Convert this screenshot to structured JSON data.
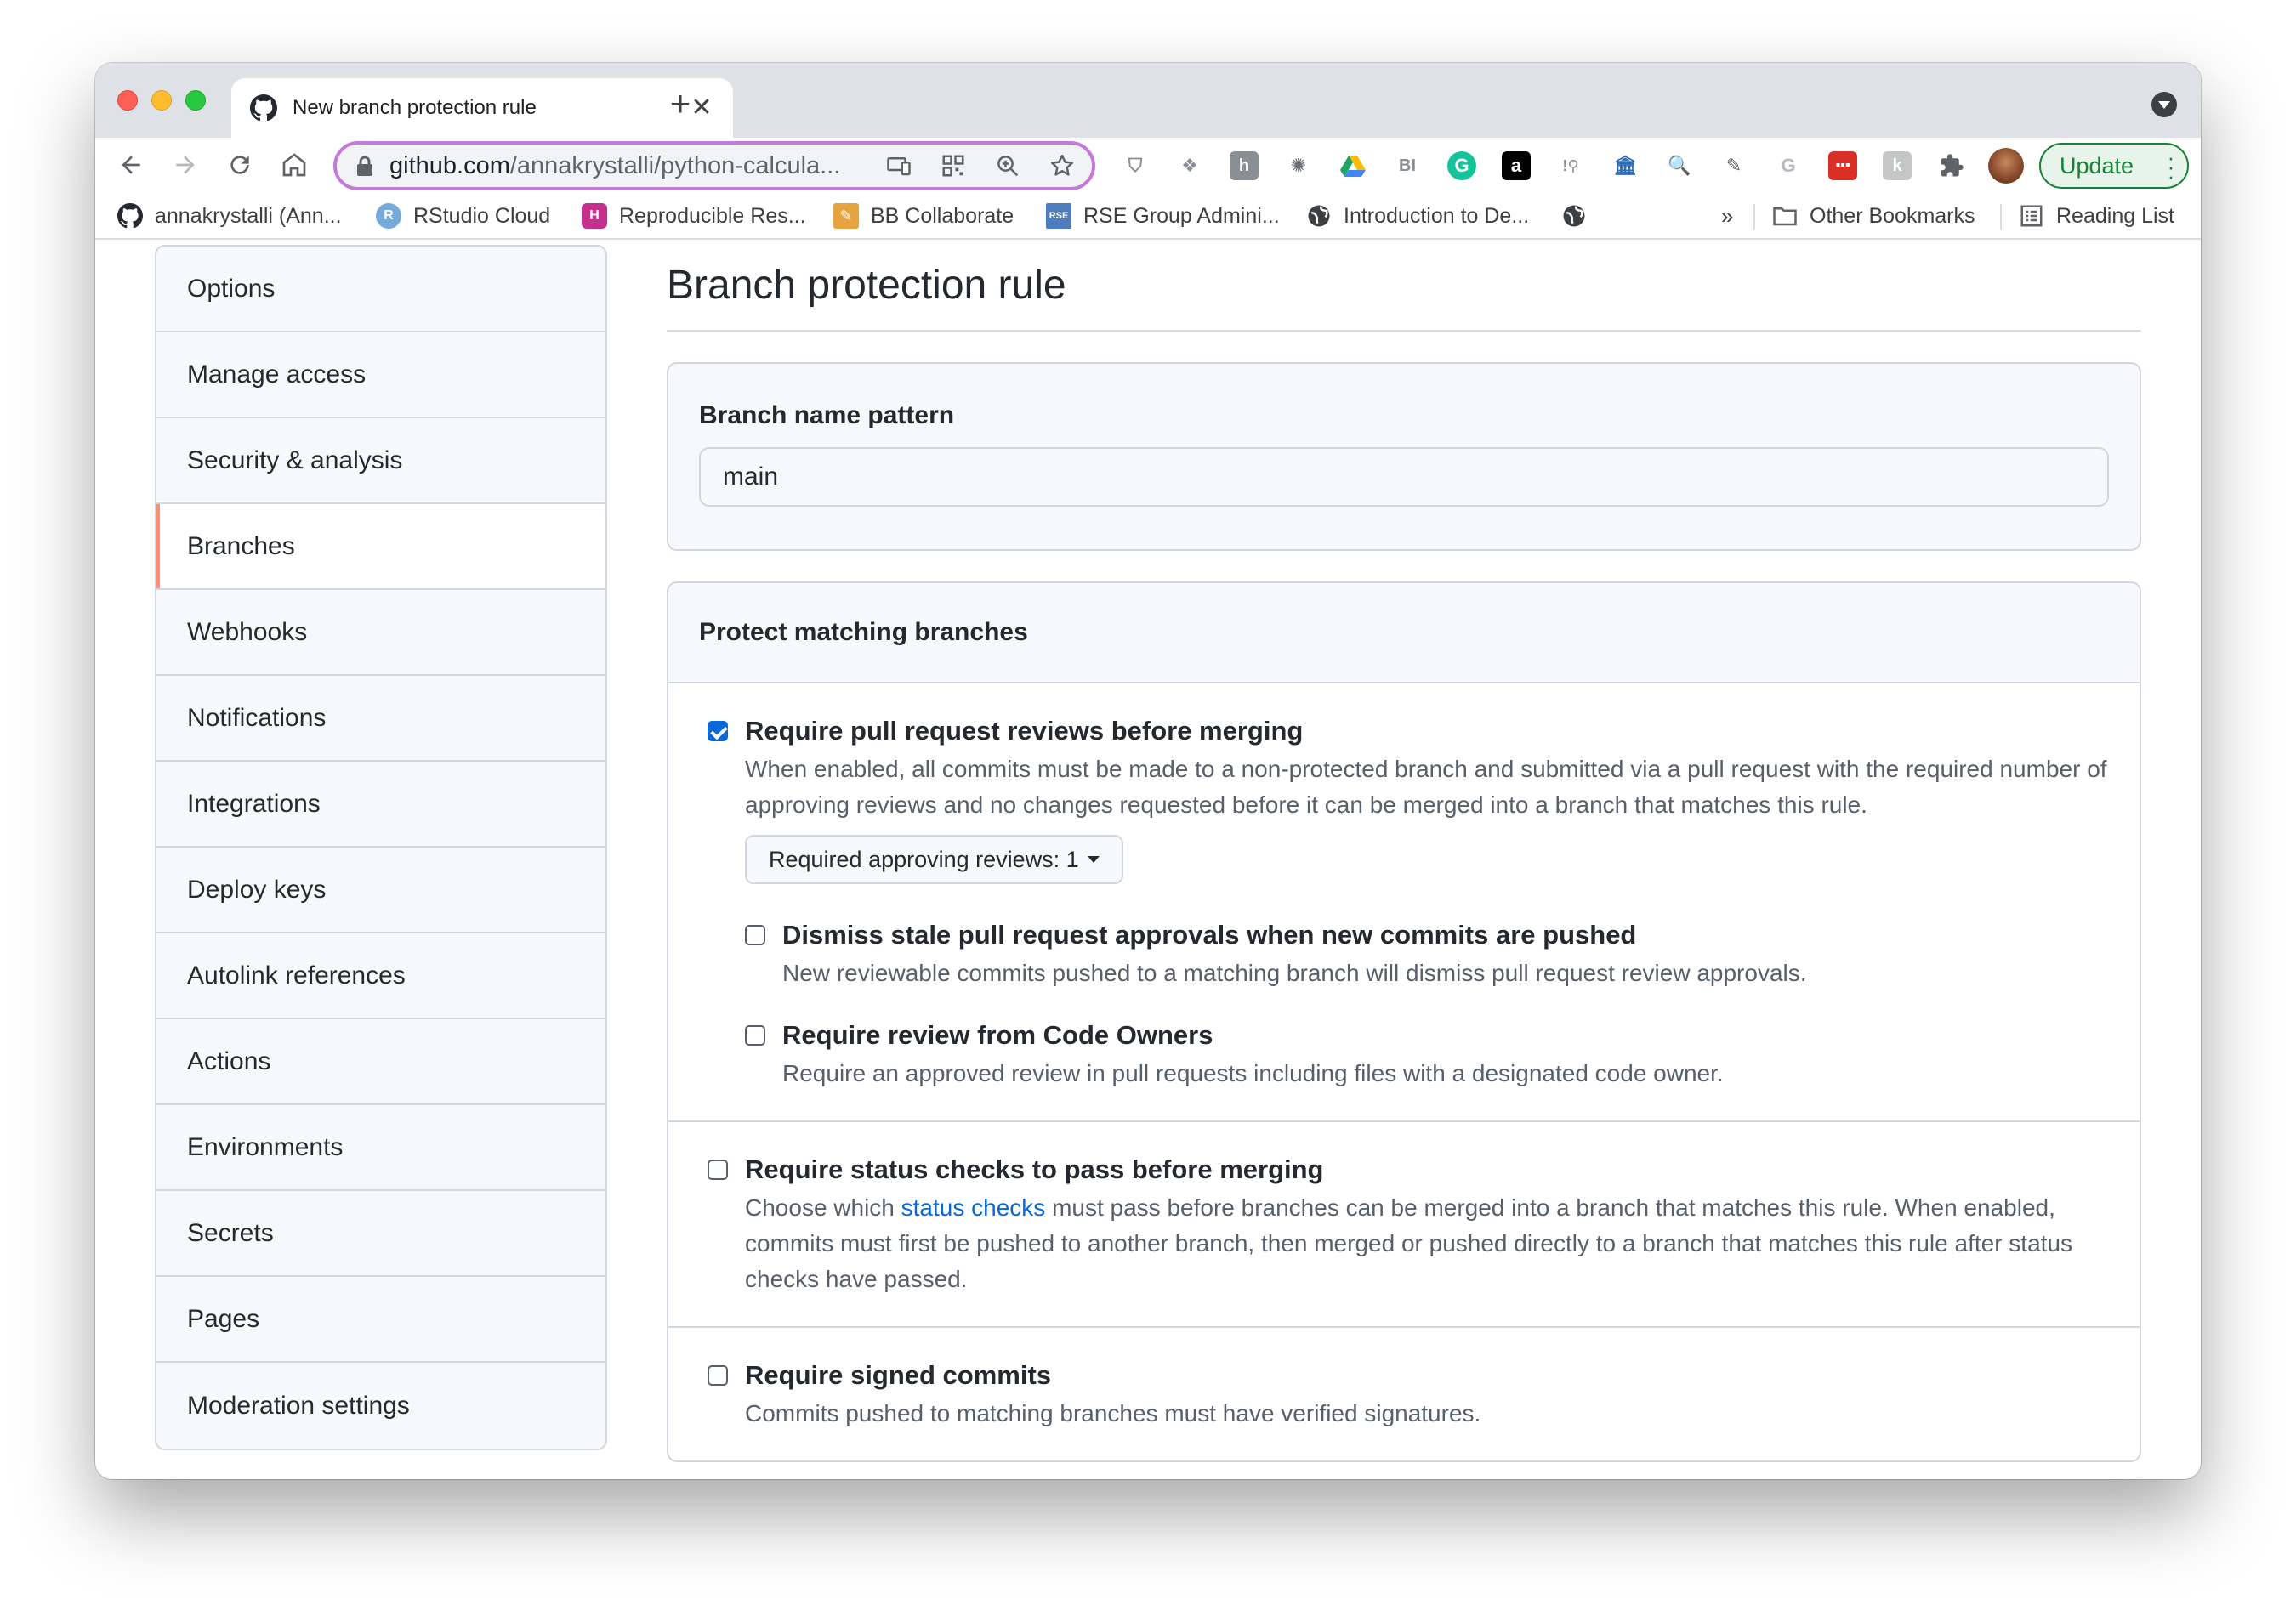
{
  "browser": {
    "tab_title": "New branch protection rule",
    "tab_close": "✕",
    "new_tab": "+",
    "url_host": "github.com",
    "url_path": "/annakrystalli/python-calcula...",
    "update_label": "Update",
    "update_menu": "⋮"
  },
  "bookmarks": {
    "items": [
      {
        "label": "annakrystalli (Ann...",
        "icon": "github-icon"
      },
      {
        "label": "RStudio Cloud",
        "icon": "r-icon",
        "icon_text": "R",
        "color": "#75aadb"
      },
      {
        "label": "Reproducible Res...",
        "icon": "hex-icon",
        "icon_text": "H",
        "color": "#c5308f"
      },
      {
        "label": "BB Collaborate",
        "icon": "pencil-icon",
        "color": "#e7a33e"
      },
      {
        "label": "RSE Group Admini...",
        "icon": "rse-icon",
        "icon_text": "RSE",
        "color": "#4d7ebf"
      },
      {
        "label": "Introduction to De...",
        "icon": "globe-icon"
      }
    ],
    "overflow": "»",
    "other_bookmarks": "Other Bookmarks",
    "reading_list": "Reading List"
  },
  "sidebar": {
    "items": [
      {
        "label": "Options"
      },
      {
        "label": "Manage access"
      },
      {
        "label": "Security & analysis"
      },
      {
        "label": "Branches",
        "selected": true
      },
      {
        "label": "Webhooks"
      },
      {
        "label": "Notifications"
      },
      {
        "label": "Integrations"
      },
      {
        "label": "Deploy keys"
      },
      {
        "label": "Autolink references"
      },
      {
        "label": "Actions"
      },
      {
        "label": "Environments"
      },
      {
        "label": "Secrets"
      },
      {
        "label": "Pages"
      },
      {
        "label": "Moderation settings"
      }
    ]
  },
  "main": {
    "title": "Branch protection rule",
    "pattern_label": "Branch name pattern",
    "pattern_value": "main",
    "protect_header": "Protect matching branches",
    "rules": [
      {
        "title": "Require pull request reviews before merging",
        "checked": true,
        "desc": "When enabled, all commits must be made to a non-protected branch and submitted via a pull request with the required number of approving reviews and no changes requested before it can be merged into a branch that matches this rule.",
        "dropdown_label": "Required approving reviews: 1",
        "subrules": [
          {
            "title": "Dismiss stale pull request approvals when new commits are pushed",
            "checked": false,
            "desc": "New reviewable commits pushed to a matching branch will dismiss pull request review approvals."
          },
          {
            "title": "Require review from Code Owners",
            "checked": false,
            "desc": "Require an approved review in pull requests including files with a designated code owner."
          }
        ]
      },
      {
        "title": "Require status checks to pass before merging",
        "checked": false,
        "desc_before": "Choose which ",
        "desc_link": "status checks",
        "desc_after": " must pass before branches can be merged into a branch that matches this rule. When enabled, commits must first be pushed to another branch, then merged or pushed directly to a branch that matches this rule after status checks have passed."
      },
      {
        "title": "Require signed commits",
        "checked": false,
        "desc": "Commits pushed to matching branches must have verified signatures."
      }
    ]
  },
  "colors": {
    "link": "#0969da",
    "selected_accent": "#fd8c73",
    "checkbox_checked": "#0969da",
    "omnibox_focus": "#c47ad9",
    "update_green": "#188038"
  }
}
